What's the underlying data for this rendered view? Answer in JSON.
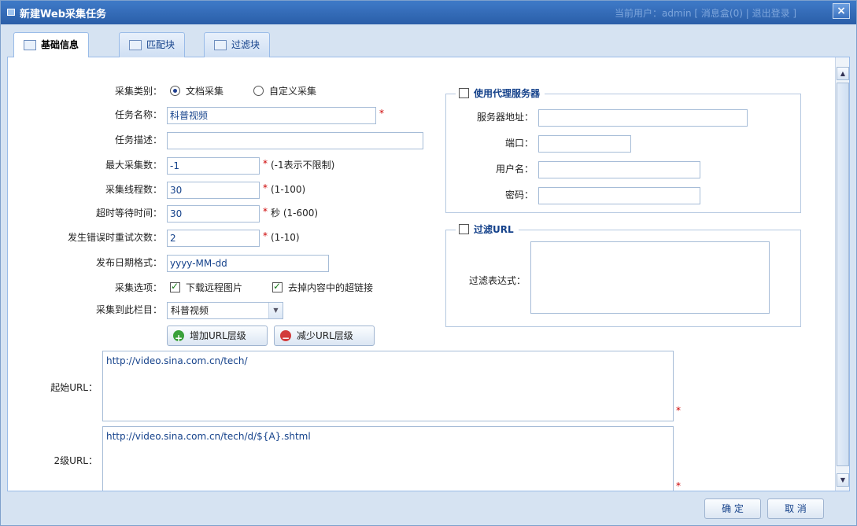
{
  "window": {
    "title": "新建Web采集任务",
    "ghost_text": "当前用户：admin  [ 消息盒(0) | 退出登录 ]",
    "close_label": "×"
  },
  "tabs": [
    {
      "label": "基础信息"
    },
    {
      "label": "匹配块"
    },
    {
      "label": "过滤块"
    }
  ],
  "form": {
    "category": {
      "label": "采集类别：",
      "opt1": "文档采集",
      "opt2": "自定义采集"
    },
    "task_name": {
      "label": "任务名称：",
      "value": "科普视频"
    },
    "task_desc": {
      "label": "任务描述：",
      "value": ""
    },
    "max_count": {
      "label": "最大采集数：",
      "value": "-1",
      "hint": "(-1表示不限制)"
    },
    "threads": {
      "label": "采集线程数：",
      "value": "30",
      "hint": "(1-100)"
    },
    "timeout": {
      "label": "超时等待时间：",
      "value": "30",
      "hint": "秒 (1-600)"
    },
    "retries": {
      "label": "发生错误时重试次数：",
      "value": "2",
      "hint": "(1-10)"
    },
    "date_format": {
      "label": "发布日期格式：",
      "value": "yyyy-MM-dd"
    },
    "options": {
      "label": "采集选项：",
      "opt1": "下载远程图片",
      "opt2": "去掉内容中的超链接"
    },
    "column": {
      "label": "采集到此栏目：",
      "value": "科普视频"
    },
    "add_level": "增加URL层级",
    "remove_level": "减少URL层级",
    "start_url": {
      "label": "起始URL：",
      "value": "http://video.sina.com.cn/tech/"
    },
    "level2_url": {
      "label": "2级URL：",
      "value": "http://video.sina.com.cn/tech/d/${A}.shtml"
    },
    "required_mark": "*"
  },
  "proxy": {
    "legend": "使用代理服务器",
    "address": {
      "label": "服务器地址：",
      "value": ""
    },
    "port": {
      "label": "端口：",
      "value": ""
    },
    "username": {
      "label": "用户名：",
      "value": ""
    },
    "password": {
      "label": "密码：",
      "value": ""
    }
  },
  "filter": {
    "legend": "过滤URL",
    "expr": {
      "label": "过滤表达式：",
      "value": ""
    }
  },
  "footer": {
    "ok": "确 定",
    "cancel": "取 消"
  }
}
